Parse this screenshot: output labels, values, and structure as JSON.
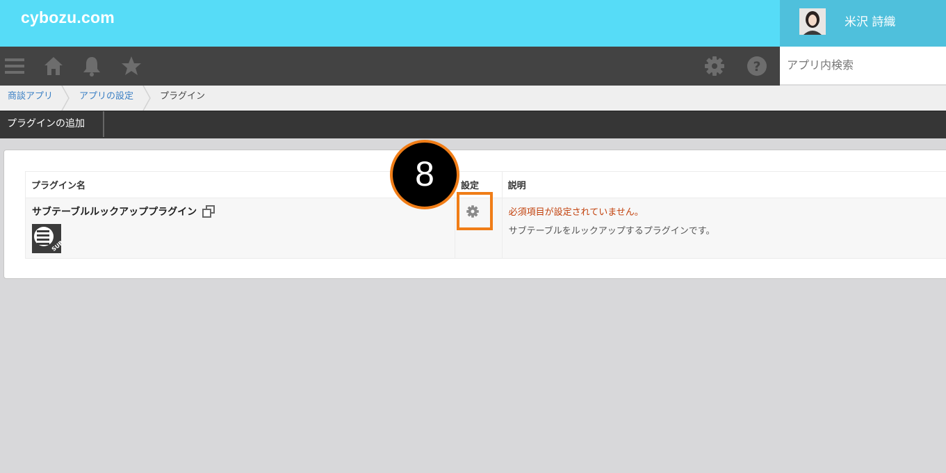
{
  "header": {
    "logo": "cybozu.com",
    "user_name": "米沢 詩織"
  },
  "navbar": {
    "icons": [
      "menu-icon",
      "home-icon",
      "bell-icon",
      "star-icon",
      "gear-icon",
      "help-icon"
    ]
  },
  "search": {
    "placeholder": "アプリ内検索"
  },
  "breadcrumb": {
    "items": [
      "商談アプリ",
      "アプリの設定",
      "プラグイン"
    ]
  },
  "toolbar": {
    "add_plugin_label": "プラグインの追加"
  },
  "plugin_table": {
    "headers": {
      "name": "プラグイン名",
      "settings": "設定",
      "description": "説明"
    },
    "rows": [
      {
        "name": "サブテーブルルックアッププラグイン",
        "logo_text": "SUB",
        "error": "必須項目が設定されていません。",
        "description": "サブテーブルをルックアップするプラグインです。"
      }
    ]
  },
  "annotation": {
    "step_number": "8",
    "accent_color": "#f07d17"
  },
  "colors": {
    "header": "#56dcf7",
    "user_box": "#4fc0dc",
    "navbar": "#434343",
    "link": "#3a7fc4",
    "error": "#c2410c"
  }
}
